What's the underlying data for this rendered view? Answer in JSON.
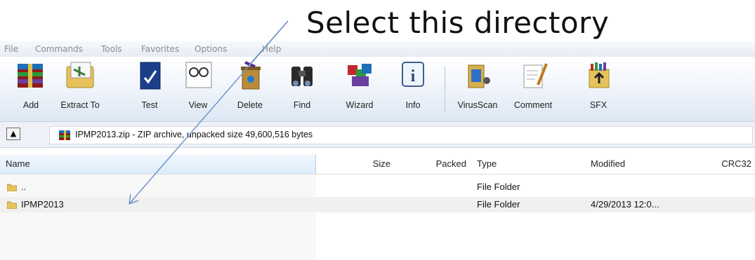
{
  "annotation": {
    "text": "Select this directory"
  },
  "menu": [
    "File",
    "Commands",
    "Tools",
    "Favorites",
    "Options",
    "Help"
  ],
  "toolbar": [
    {
      "label": "Add",
      "icon": "add-archive-icon"
    },
    {
      "label": "Extract To",
      "icon": "extract-icon"
    },
    {
      "label": "Test",
      "icon": "test-icon"
    },
    {
      "label": "View",
      "icon": "view-icon"
    },
    {
      "label": "Delete",
      "icon": "delete-icon"
    },
    {
      "label": "Find",
      "icon": "find-binoculars-icon"
    },
    {
      "label": "Wizard",
      "icon": "wizard-icon"
    },
    {
      "label": "Info",
      "icon": "info-icon"
    },
    {
      "label": "VirusScan",
      "icon": "virusscan-icon"
    },
    {
      "label": "Comment",
      "icon": "comment-icon"
    },
    {
      "label": "SFX",
      "icon": "sfx-icon"
    }
  ],
  "path": {
    "text": "IPMP2013.zip - ZIP archive, unpacked size 49,600,516 bytes"
  },
  "columns": [
    "Name",
    "Size",
    "Packed",
    "Type",
    "Modified",
    "CRC32"
  ],
  "rows": [
    {
      "name": "..",
      "size": "",
      "packed": "",
      "type": "File Folder",
      "modified": "",
      "crc": ""
    },
    {
      "name": "IPMP2013",
      "size": "",
      "packed": "",
      "type": "File Folder",
      "modified": "4/29/2013 12:0...",
      "crc": ""
    }
  ],
  "colors": {
    "selected_row": "#f0f0f0",
    "header_active": "#dcebfa",
    "arrow": "#6f95c8"
  }
}
